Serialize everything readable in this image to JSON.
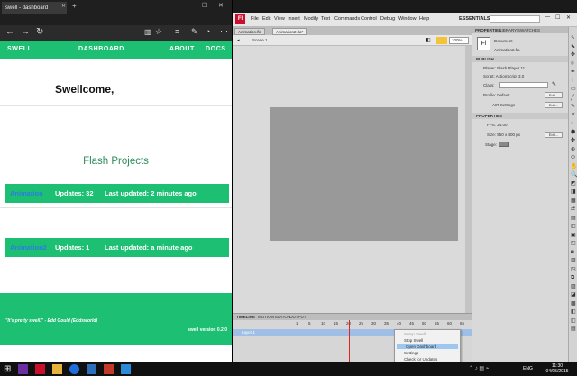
{
  "browser": {
    "tab_title": "swell - dashboard",
    "new_tab": "+",
    "nav": {
      "brand": "SWELL",
      "dashboard": "DASHBOARD",
      "about": "ABOUT",
      "docs": "DOCS"
    },
    "welcome": "Swellcome,",
    "section_title": "Flash Projects",
    "projects": [
      {
        "name": "Animation",
        "updates": "Updates: 32",
        "last": "Last updated: 2 minutes ago"
      },
      {
        "name": "Animation2",
        "updates": "Updates: 1",
        "last": "Last updated: a minute ago"
      }
    ],
    "quote": "\"It's pretty swell.\" - Edd Gould (Eddsworld)",
    "version": "swell version 0.2.0"
  },
  "flash": {
    "logo": "Fl",
    "menu": [
      "File",
      "Edit",
      "View",
      "Insert",
      "Modify",
      "Text",
      "Commands",
      "Control",
      "Debug",
      "Window",
      "Help"
    ],
    "workspace": "ESSENTIALS",
    "doc_tabs": [
      "Animation.fla",
      "Animation2.fla*"
    ],
    "scene": "Scene 1",
    "zoom": "100%",
    "panel_tabs": [
      "PROPERTIES",
      "LIBRARY",
      "SWATCHES"
    ],
    "doc_label": "Document",
    "doc_name": "Animation2.fla",
    "publish": "PUBLISH",
    "player": "Player: Flash Player 11",
    "script": "Script: ActionScript 3.0",
    "class": "Class:",
    "profile": "Profile: Default",
    "air": "AIR Settings",
    "edit": "Edit...",
    "properties": "PROPERTIES",
    "fps": "FPS: 24.00",
    "size": "Size: 550 x 400 px",
    "stage": "Stage:",
    "timeline_tabs": [
      "TIMELINE",
      "MOTION EDITOR",
      "OUTPUT"
    ],
    "layer": "Layer 1",
    "frames": [
      "1",
      "5",
      "10",
      "15",
      "20",
      "25",
      "30",
      "35",
      "40",
      "45",
      "50",
      "55",
      "60",
      "65"
    ]
  },
  "context_menu": [
    "Setup Swell",
    "Stop Swell",
    "Open Dashboard",
    "Settings",
    "Check for Updates",
    "Exit Swell"
  ],
  "taskbar": {
    "lang": "ENG",
    "time": "11:30",
    "date": "04/05/2015"
  }
}
